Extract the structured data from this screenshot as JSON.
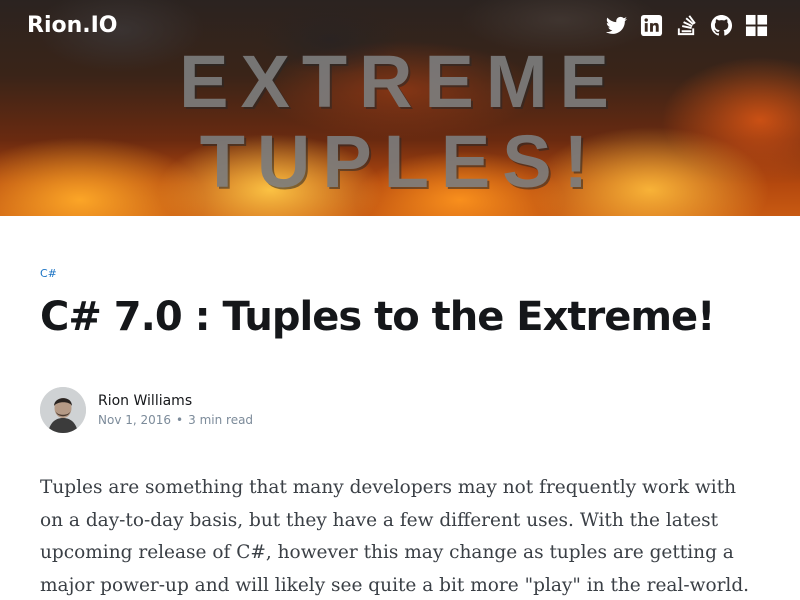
{
  "site": {
    "brand": "Rion.IO",
    "social": [
      {
        "icon": "twitter-icon"
      },
      {
        "icon": "linkedin-icon"
      },
      {
        "icon": "stackoverflow-icon"
      },
      {
        "icon": "github-icon"
      },
      {
        "icon": "windows-icon"
      }
    ]
  },
  "hero": {
    "line1": "EXTREME",
    "line2": "TUPLES!"
  },
  "post": {
    "tag": "C#",
    "title": "C# 7.0 : Tuples to the Extreme!",
    "author": "Rion Williams",
    "date": "Nov 1, 2016",
    "separator": "•",
    "read_time": "3 min read",
    "intro": "Tuples are something that many developers may not frequently work with on a day-to-day basis, but they have a few different uses. With the latest upcoming release of C#, however this may change as tuples are getting a major power-up and will likely see quite a bit more \"play\" in the real-world."
  },
  "colors": {
    "tag": "#1a73c4",
    "meta": "#7c8b9a",
    "title": "#15171a",
    "body": "#3a3f45"
  }
}
